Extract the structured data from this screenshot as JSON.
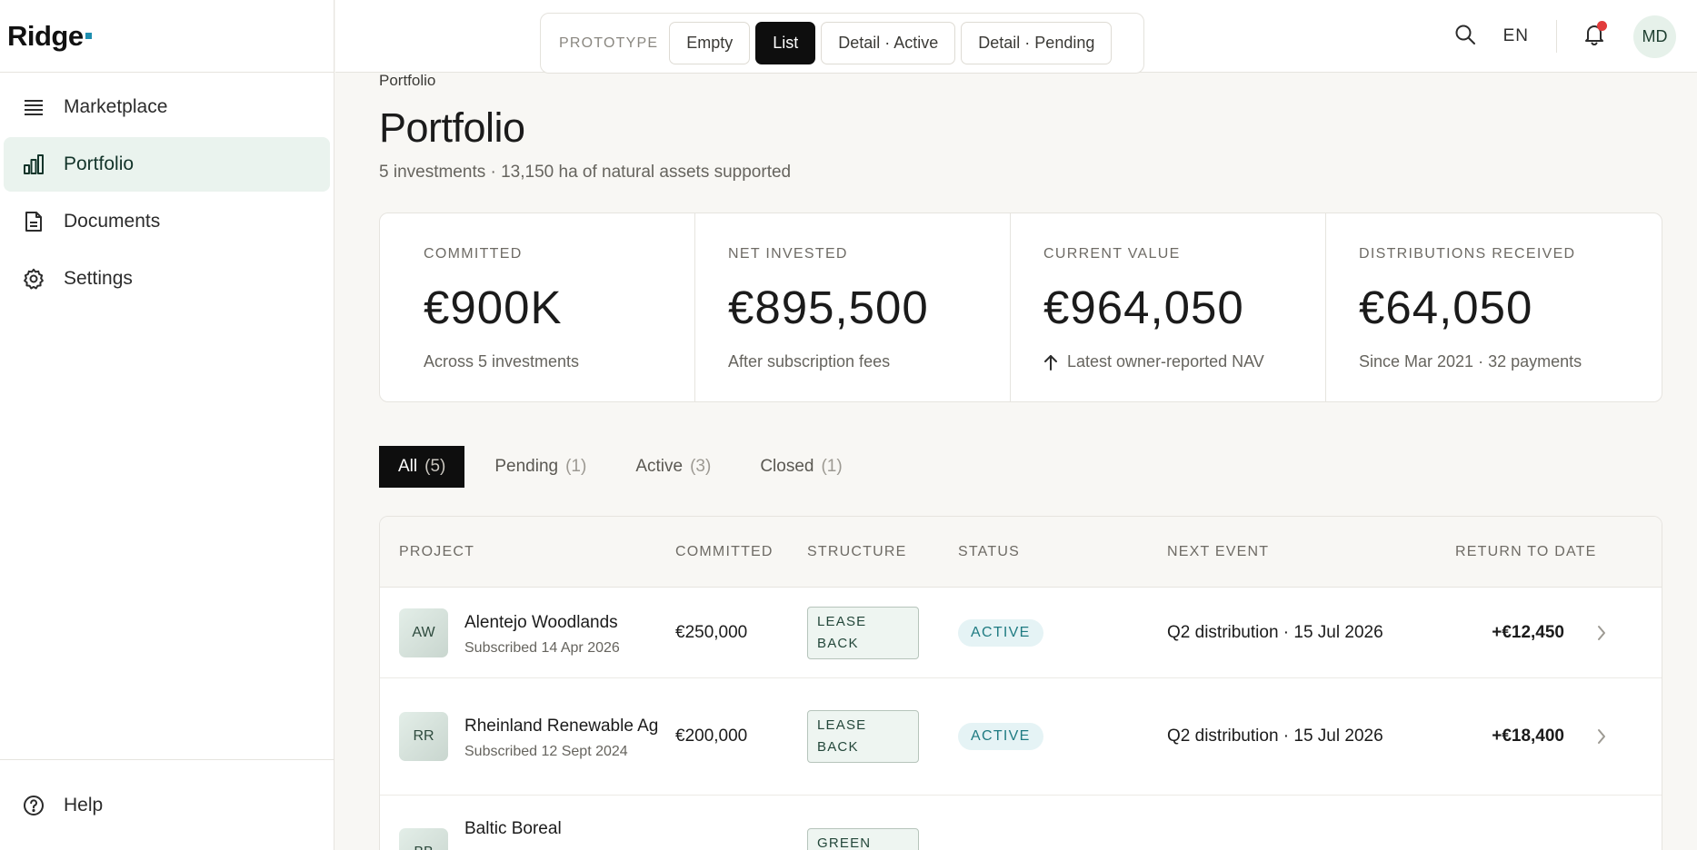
{
  "brand": {
    "name": "Ridge"
  },
  "sidebar": {
    "items": [
      {
        "label": "Marketplace",
        "icon": "list-icon"
      },
      {
        "label": "Portfolio",
        "icon": "bar-chart-icon"
      },
      {
        "label": "Documents",
        "icon": "document-icon"
      },
      {
        "label": "Settings",
        "icon": "gear-icon"
      }
    ],
    "help": "Help"
  },
  "topbar": {
    "prototype_label": "PROTOTYPE",
    "prototype_buttons": [
      "Empty",
      "List",
      "Detail · Active",
      "Detail · Pending"
    ],
    "language": "EN",
    "avatar": "MD"
  },
  "page": {
    "breadcrumb": "Portfolio",
    "title": "Portfolio",
    "subtitle": "5 investments · 13,150 ha of natural assets supported"
  },
  "stats": [
    {
      "label": "COMMITTED",
      "value": "€900K",
      "note": "Across 5 investments"
    },
    {
      "label": "NET INVESTED",
      "value": "€895,500",
      "note": "After subscription fees"
    },
    {
      "label": "CURRENT VALUE",
      "value": "€964,050",
      "note": "Latest owner-reported NAV"
    },
    {
      "label": "DISTRIBUTIONS RECEIVED",
      "value": "€64,050",
      "note": "Since Mar 2021 · 32 payments"
    }
  ],
  "tabs": [
    {
      "label": "All",
      "count": "(5)"
    },
    {
      "label": "Pending",
      "count": "(1)"
    },
    {
      "label": "Active",
      "count": "(3)"
    },
    {
      "label": "Closed",
      "count": "(1)"
    }
  ],
  "table": {
    "headers": [
      "PROJECT",
      "COMMITTED",
      "STRUCTURE",
      "STATUS",
      "NEXT EVENT",
      "RETURN TO DATE"
    ],
    "rows": [
      {
        "initials": "AW",
        "name": "Alentejo Woodlands",
        "sub": "Subscribed 14 Apr 2026",
        "committed": "€250,000",
        "structure": "LEASE BACK",
        "status": "ACTIVE",
        "next": "Q2 distribution · 15 Jul 2026",
        "ret": "+€12,450"
      },
      {
        "initials": "RR",
        "name": "Rheinland Renewable Ag",
        "sub": "Subscribed 12 Sept 2024",
        "committed": "€200,000",
        "structure": "LEASE BACK",
        "status": "ACTIVE",
        "next": "Q2 distribution · 15 Jul 2026",
        "ret": "+€18,400"
      },
      {
        "initials": "BB",
        "name": "Baltic Boreal",
        "sub": "",
        "committed": "",
        "structure": "GREEN",
        "status": "",
        "next": "",
        "ret": ""
      }
    ]
  },
  "colors": {
    "accent": "#0e0e0e",
    "active_nav_bg": "#eaf3ee",
    "status_active": "#1f7b82",
    "notification_dot": "#e23b3b",
    "brand_dot": "#1f8fb0"
  }
}
